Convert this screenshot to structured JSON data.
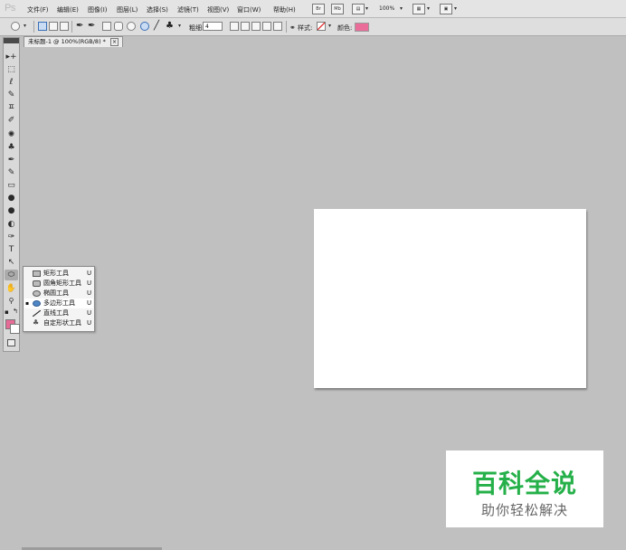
{
  "app": {
    "logo": "Ps"
  },
  "menubar": {
    "items": [
      "文件(F)",
      "编辑(E)",
      "图像(I)",
      "图层(L)",
      "选择(S)",
      "滤镜(T)",
      "视图(V)",
      "窗口(W)",
      "帮助(H)"
    ],
    "br_label": "Br",
    "mb_label": "Mb",
    "zoom": "100%"
  },
  "options": {
    "weight_label": "粗细:",
    "weight_value": "4",
    "style_label": "样式:",
    "color_label": "颜色:",
    "color_value": "#ea6d99"
  },
  "document": {
    "tab_title": "未标题-1 @ 100%(RGB/8) *",
    "close_glyph": "×"
  },
  "toolbox": {
    "tools": [
      "▸+",
      "⬚",
      "ℓ",
      "✎",
      "ㅍ",
      "✐",
      "✺",
      "♣",
      "✒",
      "✎",
      "▭",
      "●",
      "●",
      "✑",
      "T",
      "↖",
      "⬭",
      "✋",
      "🔍"
    ],
    "foreground_color": "#e66b96",
    "background_color": "#ffffff"
  },
  "flyout": {
    "items": [
      {
        "label": "矩形工具",
        "key": "U",
        "bullet": "",
        "icon": "rectangle-icon"
      },
      {
        "label": "圆角矩形工具",
        "key": "U",
        "bullet": "",
        "icon": "rounded-rectangle-icon"
      },
      {
        "label": "椭圆工具",
        "key": "U",
        "bullet": "",
        "icon": "ellipse-icon"
      },
      {
        "label": "多边形工具",
        "key": "U",
        "bullet": "▪",
        "icon": "polygon-icon"
      },
      {
        "label": "直线工具",
        "key": "U",
        "bullet": "",
        "icon": "line-icon"
      },
      {
        "label": "自定形状工具",
        "key": "U",
        "bullet": "",
        "icon": "custom-shape-icon"
      }
    ]
  },
  "watermark": {
    "title": "百科全说",
    "subtitle": "助你轻松解决"
  }
}
